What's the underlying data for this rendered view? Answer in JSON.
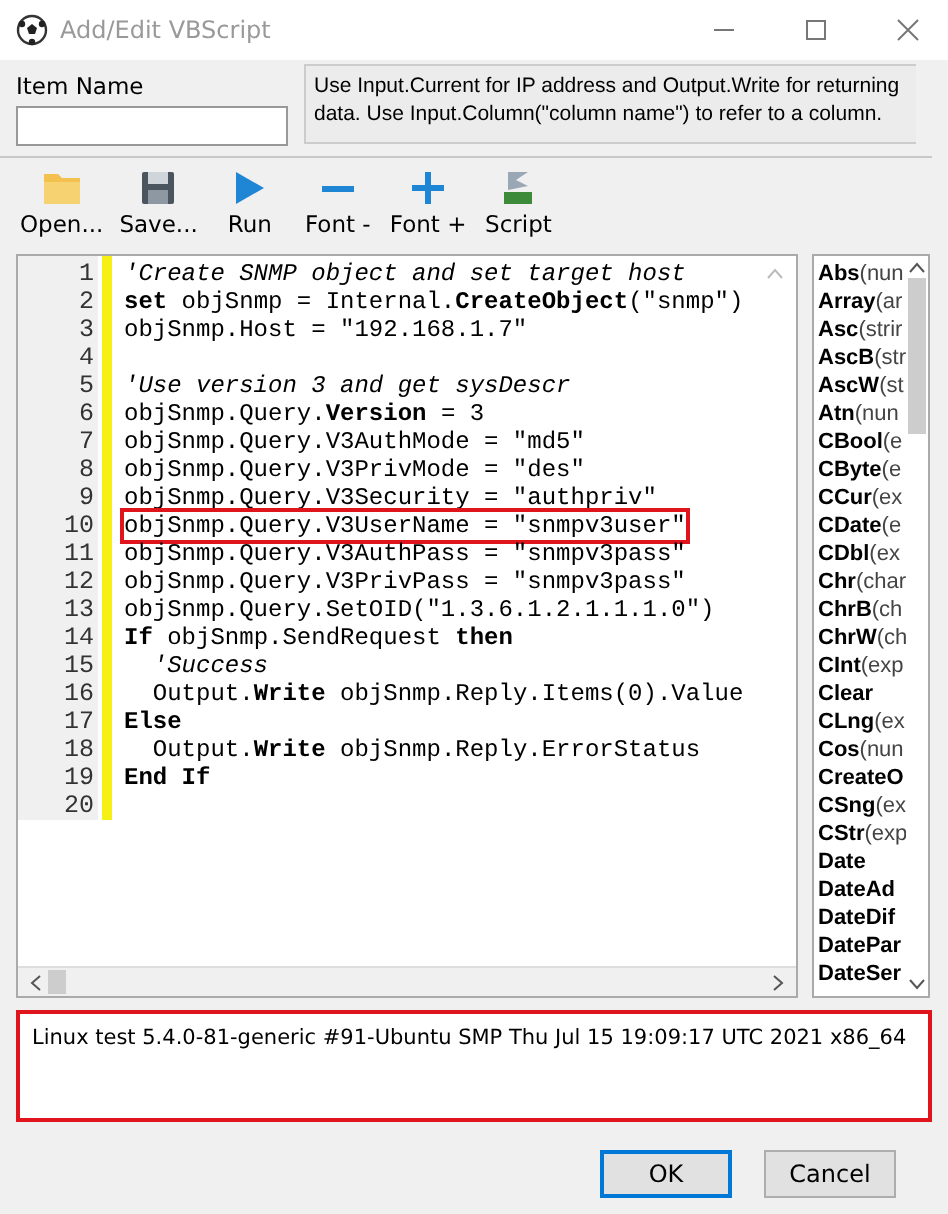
{
  "window": {
    "title": "Add/Edit VBScript"
  },
  "item_name": {
    "label": "Item Name"
  },
  "hint": "Use Input.Current for IP address and Output.Write for returning data. Use Input.Column(\"column name\") to refer to a column.",
  "toolbar": [
    {
      "label": "Open...",
      "kind": "open"
    },
    {
      "label": "Save...",
      "kind": "save"
    },
    {
      "label": "Run",
      "kind": "run"
    },
    {
      "label": "Font -",
      "kind": "minus"
    },
    {
      "label": "Font +",
      "kind": "plus"
    },
    {
      "label": "Script",
      "kind": "script"
    }
  ],
  "code_lines": [
    {
      "number": "1",
      "kind": "comment",
      "text": "'Create SNMP object and set target host",
      "highlighted": false
    },
    {
      "number": "2",
      "kind": "code",
      "text": "**set** objSnmp = Internal.**CreateObject**(\"snmp\")",
      "highlighted": false
    },
    {
      "number": "3",
      "kind": "code",
      "text": "objSnmp.Host = \"192.168.1.7\"",
      "highlighted": false
    },
    {
      "number": "4"
    },
    {
      "number": "5",
      "kind": "comment",
      "text": "'Use version 3 and get sysDescr",
      "highlighted": false
    },
    {
      "number": "6",
      "kind": "code",
      "text": "objSnmp.Query.**Version** = 3",
      "highlighted": false
    },
    {
      "number": "7",
      "kind": "code",
      "text": "objSnmp.Query.V3AuthMode = \"md5\"",
      "highlighted": false
    },
    {
      "number": "8",
      "kind": "code",
      "text": "objSnmp.Query.V3PrivMode = \"des\"",
      "highlighted": false
    },
    {
      "number": "9",
      "kind": "code",
      "text": "objSnmp.Query.V3Security = \"authpriv\"",
      "highlighted": false
    },
    {
      "number": "10",
      "kind": "code",
      "text": "objSnmp.Query.V3UserName = \"snmpv3user\"",
      "highlighted": true
    },
    {
      "number": "11",
      "kind": "code",
      "text": "objSnmp.Query.V3AuthPass = \"snmpv3pass\"",
      "highlighted": false
    },
    {
      "number": "12",
      "kind": "code",
      "text": "objSnmp.Query.V3PrivPass = \"snmpv3pass\"",
      "highlighted": false
    },
    {
      "number": "13",
      "kind": "code",
      "text": "objSnmp.Query.SetOID(\"1.3.6.1.2.1.1.1.0\")",
      "highlighted": false
    },
    {
      "number": "14",
      "kind": "code",
      "text": "**If** objSnmp.SendRequest **then**",
      "highlighted": false
    },
    {
      "number": "15",
      "kind": "comment",
      "text": "  'Success",
      "highlighted": false
    },
    {
      "number": "16",
      "kind": "code",
      "text": "  Output.**Write** objSnmp.Reply.Items(0).Value",
      "highlighted": false
    },
    {
      "number": "17",
      "kind": "code",
      "text": "**Else**",
      "highlighted": false
    },
    {
      "number": "18",
      "kind": "code",
      "text": "  Output.**Write** objSnmp.Reply.ErrorStatus",
      "highlighted": false
    },
    {
      "number": "19",
      "kind": "code",
      "text": "**End If**",
      "highlighted": false
    },
    {
      "number": "20"
    }
  ],
  "functions": [
    {
      "name": "Abs",
      "args": "(nun"
    },
    {
      "name": "Array",
      "args": "(ar"
    },
    {
      "name": "Asc",
      "args": "(strir"
    },
    {
      "name": "AscB",
      "args": "(str"
    },
    {
      "name": "AscW",
      "args": "(st"
    },
    {
      "name": "Atn",
      "args": "(nun"
    },
    {
      "name": "CBool",
      "args": "(e"
    },
    {
      "name": "CByte",
      "args": "(e"
    },
    {
      "name": "CCur",
      "args": "(ex"
    },
    {
      "name": "CDate",
      "args": "(e"
    },
    {
      "name": "CDbl",
      "args": "(ex"
    },
    {
      "name": "Chr",
      "args": "(char"
    },
    {
      "name": "ChrB",
      "args": "(ch"
    },
    {
      "name": "ChrW",
      "args": "(ch"
    },
    {
      "name": "CInt",
      "args": "(exp"
    },
    {
      "name": "Clear"
    },
    {
      "name": "CLng",
      "args": "(ex"
    },
    {
      "name": "Cos",
      "args": "(nun"
    },
    {
      "name": "CreateO"
    },
    {
      "name": "CSng",
      "args": "(ex"
    },
    {
      "name": "CStr",
      "args": "(exp"
    },
    {
      "name": "Date"
    },
    {
      "name": "DateAd"
    },
    {
      "name": "DateDif"
    },
    {
      "name": "DatePar"
    },
    {
      "name": "DateSer"
    }
  ],
  "output": {
    "text": "Linux test 5.4.0-81-generic #91-Ubuntu SMP Thu Jul 15 19:09:17 UTC 2021 x86_64",
    "highlighted": true
  },
  "buttons": [
    {
      "label": "OK",
      "kind": "default"
    },
    {
      "label": "Cancel",
      "kind": "normal"
    }
  ]
}
